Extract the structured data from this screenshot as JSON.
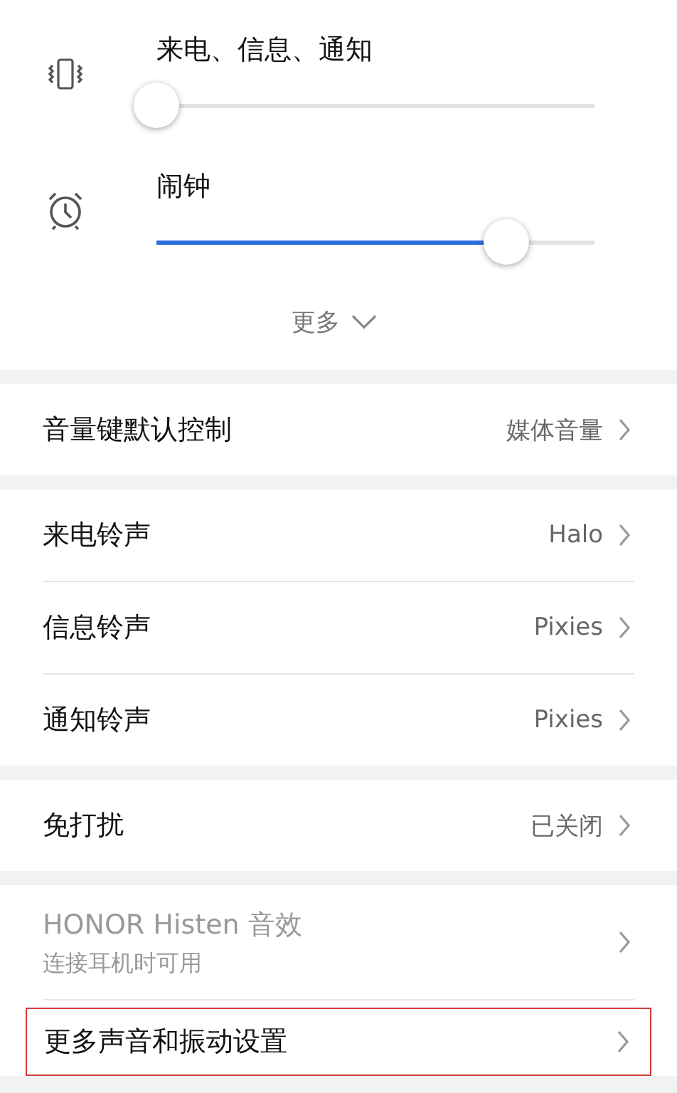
{
  "volumes": [
    {
      "label": "来电、信息、通知",
      "level": 0
    },
    {
      "label": "闹钟",
      "level": 0.8
    }
  ],
  "more": {
    "label": "更多",
    "expanded": false
  },
  "groups": [
    {
      "rows": [
        {
          "kind": "value",
          "label": "音量键默认控制",
          "value": "媒体音量",
          "highlighted": false
        }
      ]
    },
    {
      "rows": [
        {
          "kind": "value",
          "label": "来电铃声",
          "value": "Halo",
          "highlighted": false
        },
        {
          "kind": "value",
          "label": "信息铃声",
          "value": "Pixies",
          "highlighted": false
        },
        {
          "kind": "value",
          "label": "通知铃声",
          "value": "Pixies",
          "highlighted": false
        }
      ]
    },
    {
      "rows": [
        {
          "kind": "value",
          "label": "免打扰",
          "value": "已关闭",
          "highlighted": false
        }
      ]
    },
    {
      "rows": [
        {
          "kind": "disabled",
          "label": "HONOR Histen 音效",
          "subtitle": "连接耳机时可用",
          "highlighted": false
        },
        {
          "kind": "value",
          "label": "更多声音和振动设置",
          "highlighted": true
        }
      ]
    }
  ]
}
